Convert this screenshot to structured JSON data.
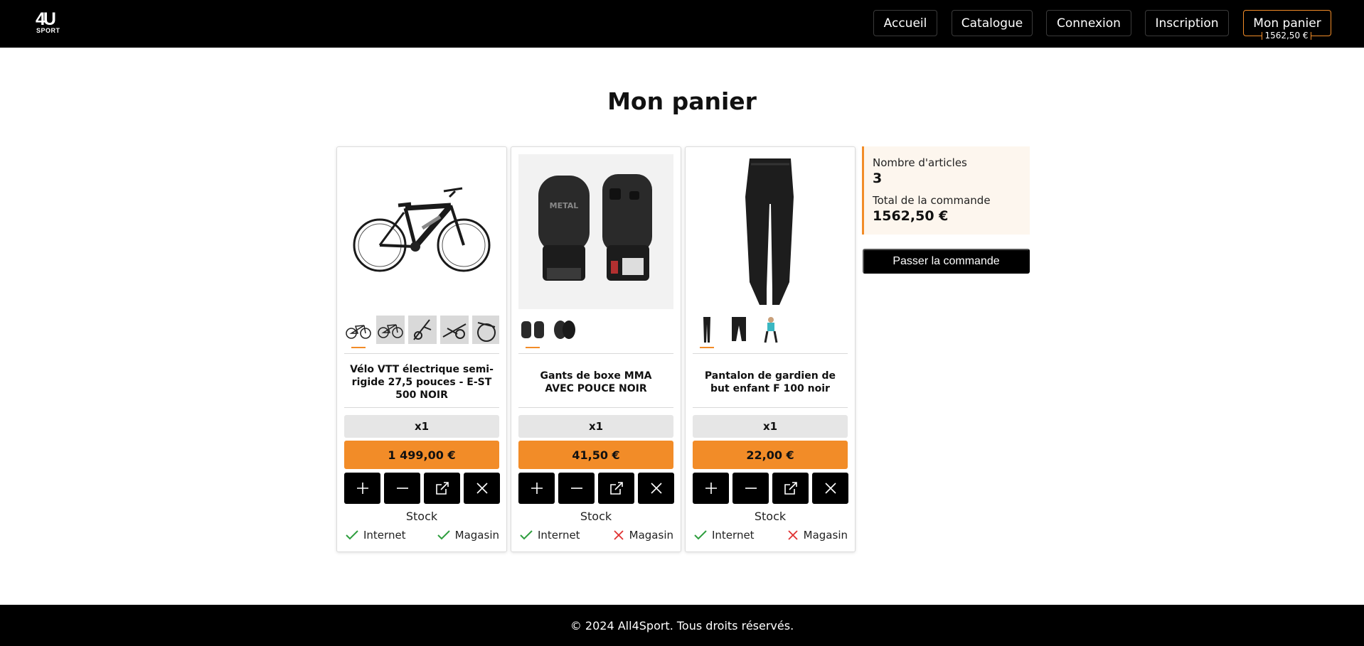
{
  "brand": {
    "logo_text": "4U",
    "logo_sub": "SPORT"
  },
  "nav": {
    "home": "Accueil",
    "catalog": "Catalogue",
    "login": "Connexion",
    "register": "Inscription",
    "cart": "Mon panier",
    "cart_total": "1562,50 €"
  },
  "page": {
    "title": "Mon panier"
  },
  "products": [
    {
      "name": "Vélo VTT électrique semi-rigide 27,5 pouces - E-ST 500 NOIR",
      "quantity": "x1",
      "price": "1 499,00 €",
      "stock_label": "Stock",
      "internet_label": "Internet",
      "internet_available": true,
      "store_label": "Magasin",
      "store_available": true,
      "thumb_count": 5
    },
    {
      "name": "Gants de boxe MMA AVEC POUCE NOIR",
      "quantity": "x1",
      "price": "41,50 €",
      "stock_label": "Stock",
      "internet_label": "Internet",
      "internet_available": true,
      "store_label": "Magasin",
      "store_available": false,
      "thumb_count": 2
    },
    {
      "name": "Pantalon de gardien de but enfant F 100 noir",
      "quantity": "x1",
      "price": "22,00 €",
      "stock_label": "Stock",
      "internet_label": "Internet",
      "internet_available": true,
      "store_label": "Magasin",
      "store_available": false,
      "thumb_count": 3
    }
  ],
  "summary": {
    "items_label": "Nombre d'articles",
    "items_count": "3",
    "total_label": "Total de la commande",
    "total_value": "1562,50 €",
    "checkout_label": "Passer la commande"
  },
  "footer": {
    "text": "© 2024 All4Sport. Tous droits réservés."
  },
  "colors": {
    "accent": "#f28c28",
    "header_bg": "#000000",
    "ok": "#2e9e3e",
    "ko": "#e03131"
  },
  "icons": [
    "plus-icon",
    "minus-icon",
    "external-link-icon",
    "close-icon",
    "check-icon",
    "cross-icon"
  ]
}
